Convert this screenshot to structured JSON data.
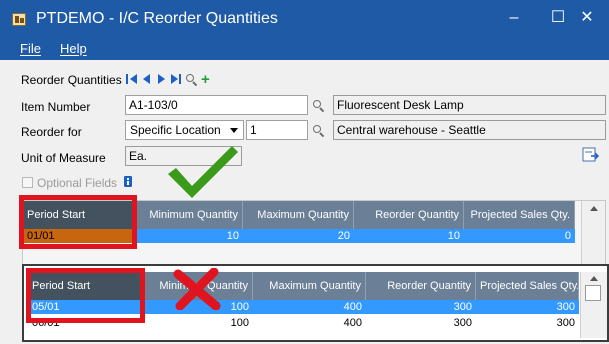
{
  "window": {
    "title": "PTDEMO - I/C Reorder Quantities",
    "minimize": "–",
    "maximize": "☐",
    "close": "✕"
  },
  "menu": {
    "file": "File",
    "help": "Help"
  },
  "form": {
    "reorder_quantities_label": "Reorder Quantities",
    "item_number_label": "Item Number",
    "item_number_value": "A1-103/0",
    "item_description": "Fluorescent Desk Lamp",
    "reorder_for_label": "Reorder for",
    "reorder_for_value": "Specific Location",
    "location_code": "1",
    "location_description": "Central warehouse - Seattle",
    "uom_label": "Unit of Measure",
    "uom_value": "Ea.",
    "optional_fields_label": "Optional Fields"
  },
  "grid_top": {
    "columns": [
      "Period Start",
      "Minimum Quantity",
      "Maximum Quantity",
      "Reorder Quantity",
      "Projected Sales Qty."
    ],
    "rows": [
      [
        "01/01",
        "10",
        "20",
        "10",
        "0"
      ]
    ]
  },
  "grid_bottom": {
    "columns": [
      "Period Start",
      "Minimum Quantity",
      "Maximum Quantity",
      "Reorder Quantity",
      "Projected Sales Qty."
    ],
    "rows": [
      [
        "05/01",
        "100",
        "400",
        "300",
        "300"
      ],
      [
        "06/01",
        "100",
        "400",
        "300",
        "300"
      ]
    ]
  },
  "colors": {
    "titlebar": "#1f5aa6",
    "highlight": "#3399ff",
    "edited_cell": "#c8650f",
    "annotation_red": "#e0141e",
    "annotation_green": "#3a9a1a"
  }
}
